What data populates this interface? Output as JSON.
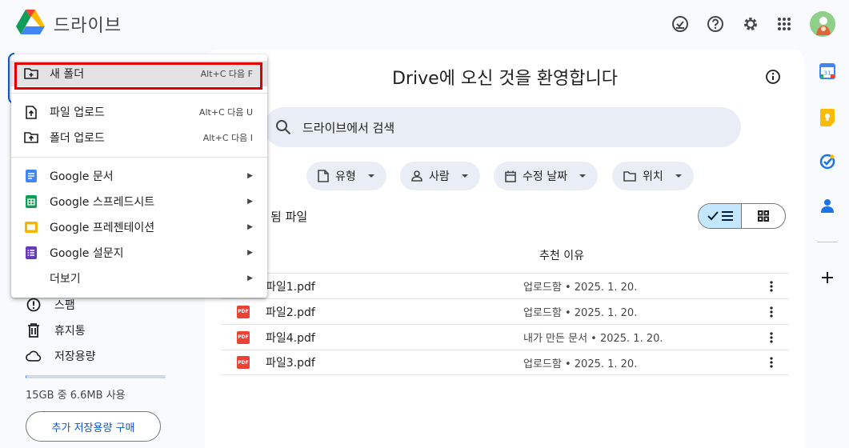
{
  "header": {
    "title": "드라이브",
    "icons": [
      "offline-check-icon",
      "help-icon",
      "settings-icon",
      "apps-grid-icon"
    ]
  },
  "sidebar": {
    "items": [
      {
        "icon": "spam-icon",
        "label": "스팸"
      },
      {
        "icon": "trash-icon",
        "label": "휴지통"
      },
      {
        "icon": "cloud-icon",
        "label": "저장용량"
      }
    ],
    "storage_text": "15GB 중 6.6MB 사용",
    "storage_used_fraction": 0.0004,
    "buy_storage_label": "추가 저장용량 구매"
  },
  "main": {
    "welcome": "Drive에 오신 것을 환영합니다",
    "search_placeholder": "드라이브에서 검색",
    "filters": [
      {
        "icon": "file-icon",
        "label": "유형"
      },
      {
        "icon": "person-icon",
        "label": "사람"
      },
      {
        "icon": "calendar-icon",
        "label": "수정 날짜"
      },
      {
        "icon": "folder-icon",
        "label": "위치"
      }
    ],
    "suggested_label": "됨 파일",
    "column_reason": "추천 이유",
    "files": [
      {
        "name": "파일1.pdf",
        "reason": "업로드함 • 2025. 1. 20."
      },
      {
        "name": "파일2.pdf",
        "reason": "업로드함 • 2025. 1. 20."
      },
      {
        "name": "파일4.pdf",
        "reason": "내가 만든 문서 • 2025. 1. 20."
      },
      {
        "name": "파일3.pdf",
        "reason": "업로드함 • 2025. 1. 20."
      }
    ],
    "pdf_label": "PDF"
  },
  "menu": {
    "new_folder": {
      "label": "새 폴더",
      "shortcut": "Alt+C 다음 F"
    },
    "file_upload": {
      "label": "파일 업로드",
      "shortcut": "Alt+C 다음 U"
    },
    "folder_upload": {
      "label": "폴더 업로드",
      "shortcut": "Alt+C 다음 I"
    },
    "google_docs": "Google 문서",
    "google_sheets": "Google 스프레드시트",
    "google_slides": "Google 프레젠테이션",
    "google_forms": "Google 설문지",
    "more": "더보기",
    "arrow": "▶"
  },
  "rail": {
    "icons": [
      "calendar-app-icon",
      "keep-app-icon",
      "tasks-app-icon",
      "contacts-app-icon",
      "add-icon"
    ],
    "calendar_day": "31"
  },
  "colors": {
    "accent": "#0b57d0",
    "highlight": "#e00000",
    "pdf": "#ea4335"
  }
}
